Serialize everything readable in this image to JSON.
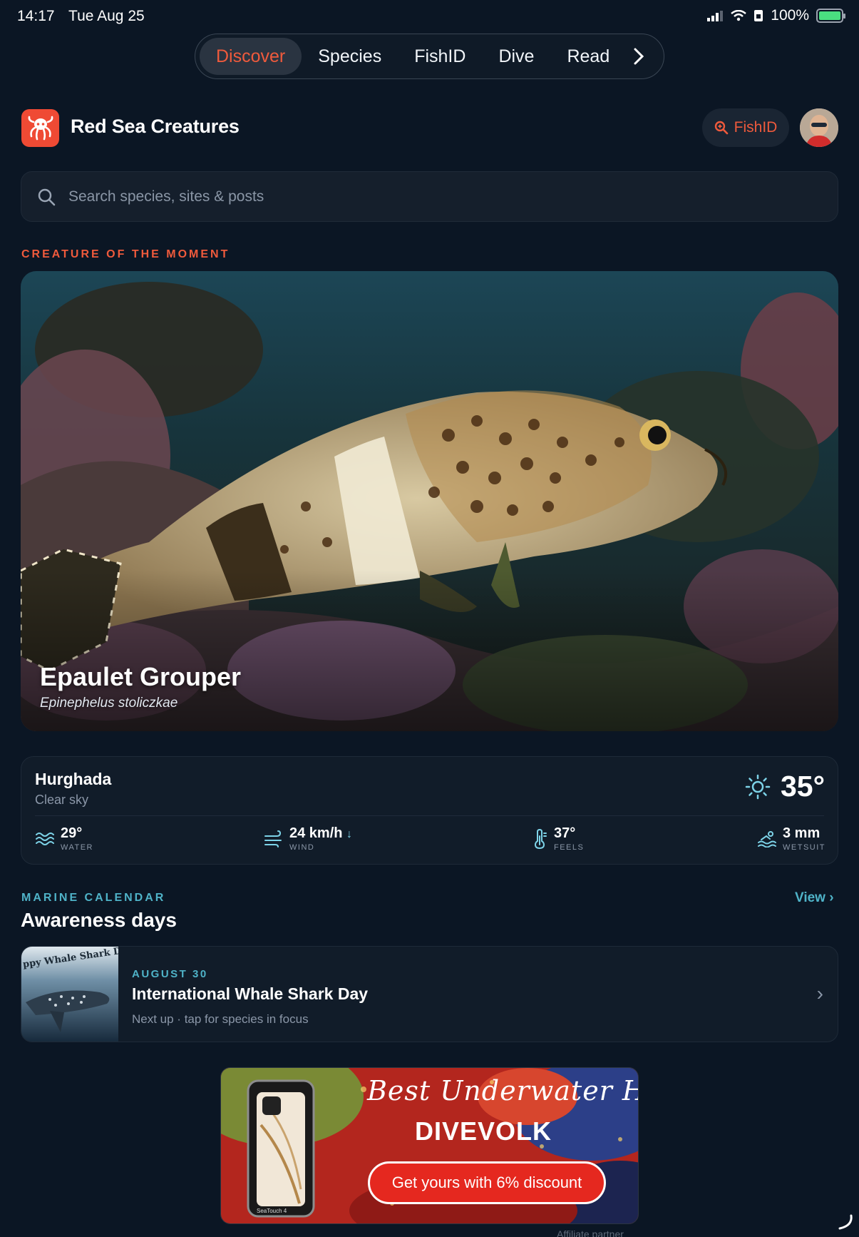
{
  "status": {
    "time": "14:17",
    "date": "Tue Aug 25",
    "battery": "100%"
  },
  "nav": {
    "tabs": [
      {
        "label": "Discover",
        "active": true
      },
      {
        "label": "Species",
        "active": false
      },
      {
        "label": "FishID",
        "active": false
      },
      {
        "label": "Dive",
        "active": false
      },
      {
        "label": "Read",
        "active": false
      }
    ],
    "more_icon": "chevron-right-icon"
  },
  "header": {
    "title": "Red Sea Creatures",
    "fishid_label": "FishID",
    "logo_icon": "octopus-icon"
  },
  "search": {
    "placeholder": "Search species, sites & posts"
  },
  "creature": {
    "section_label": "CREATURE OF THE MOMENT",
    "name": "Epaulet Grouper",
    "scientific": "Epinephelus stoliczkae"
  },
  "weather": {
    "city": "Hurghada",
    "condition": "Clear sky",
    "temp": "35°",
    "stats": [
      {
        "value": "29°",
        "label": "WATER",
        "icon": "waves-icon"
      },
      {
        "value": "24 km/h",
        "label": "WIND",
        "icon": "wind-icon"
      },
      {
        "value": "37°",
        "label": "FEELS",
        "icon": "thermometer-icon"
      },
      {
        "value": "3 mm",
        "label": "WETSUIT",
        "icon": "swimmer-icon"
      }
    ]
  },
  "calendar": {
    "section_label": "MARINE CALENDAR",
    "heading": "Awareness days",
    "view_label": "View",
    "item": {
      "date": "AUGUST 30",
      "title": "International Whale Shark Day",
      "note": "Next up · tap for species in focus",
      "thumb_text": "ppy Whale Shark D"
    }
  },
  "ad": {
    "script": "Best Underwater Housing",
    "brand": "DIVEVOLK",
    "cta": "Get yours with 6% discount",
    "device_label": "SeaTouch 4",
    "affiliate": "Affiliate partner"
  },
  "colors": {
    "accent": "#ef5a3c",
    "teal": "#4fb3c8",
    "background": "#0b1624",
    "card": "#111c29"
  }
}
